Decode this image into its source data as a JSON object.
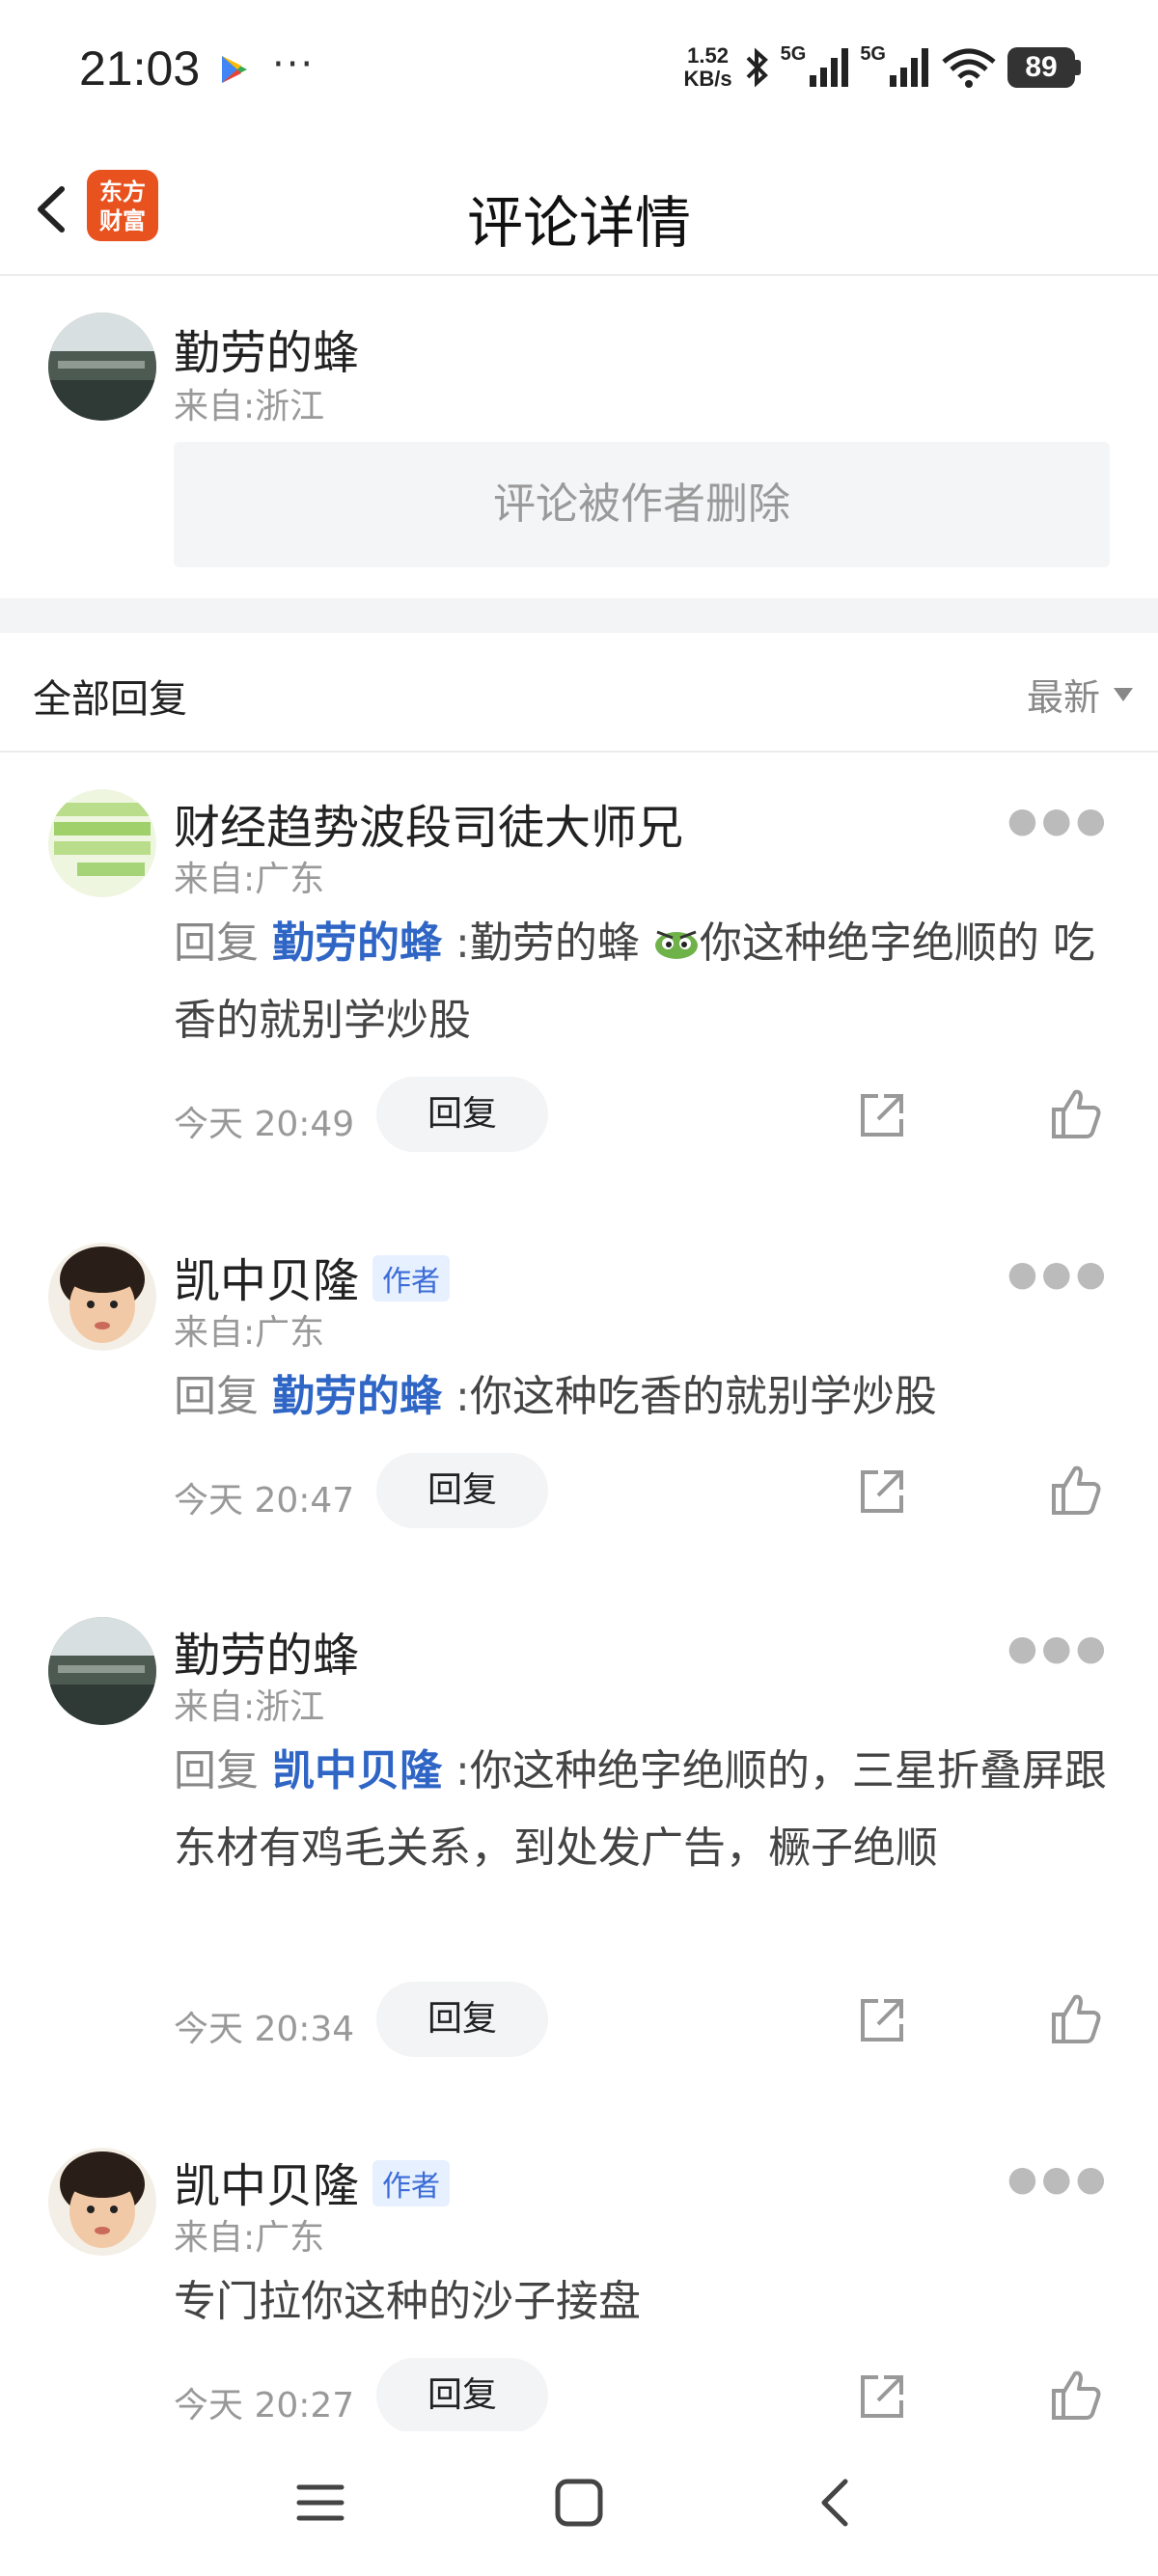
{
  "status_bar": {
    "time": "21:03",
    "dots": "···",
    "speed_value": "1.52",
    "speed_unit": "KB/s",
    "net1": "5G",
    "net2": "5G",
    "wifi_sub": "6",
    "battery": "89"
  },
  "header": {
    "title": "评论详情",
    "logo_line1": "东方",
    "logo_line2": "财富"
  },
  "main_comment": {
    "username": "勤劳的蜂",
    "location": "来自:浙江",
    "deleted_text": "评论被作者删除"
  },
  "replies_section": {
    "title": "全部回复",
    "sort_label": "最新"
  },
  "replies": [
    {
      "username": "财经趋势波段司徒大师兄",
      "location": "来自:广东",
      "prefix": "回复",
      "mention": "勤劳的蜂",
      "colon": ":",
      "text_before_sticker": "勤劳的蜂",
      "text": "你这种绝字绝顺的 吃香的就别学炒股",
      "time": "今天 20:49",
      "reply_label": "回复"
    },
    {
      "username": "凯中贝隆",
      "author_tag": "作者",
      "location": "来自:广东",
      "prefix": "回复",
      "mention": "勤劳的蜂",
      "colon": ":",
      "text": "你这种吃香的就别学炒股",
      "time": "今天 20:47",
      "reply_label": "回复"
    },
    {
      "username": "勤劳的蜂",
      "location": "来自:浙江",
      "prefix": "回复",
      "mention": "凯中贝隆",
      "colon": ":",
      "text": "你这种绝字绝顺的，三星折叠屏跟东材有鸡毛关系，到处发广告，橛子绝顺",
      "time": "今天 20:34",
      "reply_label": "回复"
    },
    {
      "username": "凯中贝隆",
      "author_tag": "作者",
      "location": "来自:广东",
      "text": "专门拉你这种的沙子接盘",
      "time": "今天 20:27",
      "reply_label": "回复"
    }
  ],
  "icons": {
    "back": "chevron-left-icon",
    "share": "share-icon",
    "like": "thumbs-up-icon",
    "more": "more-dots-icon",
    "nav_menu": "menu-icon",
    "nav_home": "home-square-icon",
    "nav_back": "back-triangle-icon"
  },
  "colors": {
    "brand": "#e8521f",
    "mention": "#2f66c6",
    "author_tag_bg": "#e6f0ff",
    "author_tag_text": "#3b6bd6"
  }
}
